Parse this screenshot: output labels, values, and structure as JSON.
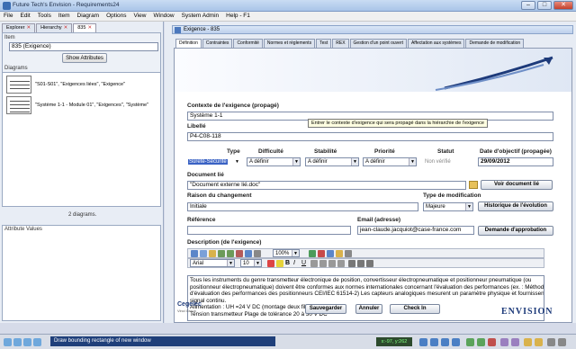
{
  "window": {
    "title": "Future Tech's Envision - Requirements24"
  },
  "menu": [
    "File",
    "Edit",
    "Tools",
    "Item",
    "Diagram",
    "Options",
    "View",
    "Window",
    "System Admin",
    "Help - F1"
  ],
  "left": {
    "tabs": [
      "Explorer",
      "Hierarchy",
      "835"
    ],
    "item_label": "Item",
    "item_value": "835 (Exigence)",
    "show_attributes": "Show Attributes",
    "diagrams_label": "Diagrams",
    "diagrams": [
      "\"S01-S01\", \"Exigences liées\", \"Exigence\"",
      "\"Système 1-1 - Module 01\", \"Exigences\", \"Système\""
    ],
    "diagrams_count": "2 diagrams.",
    "attribute_values_label": "Attribute Values"
  },
  "right": {
    "window_title": "Exigence - 835",
    "tabs": [
      "Définition",
      "Contraintes",
      "Conformité",
      "Normes et règlements",
      "Test",
      "REX",
      "Gestion d'un point ouvert",
      "Affectation aux systèmes",
      "Demande de modification"
    ],
    "form": {
      "contexte_label": "Contexte de l'exigence (propagé)",
      "contexte_value": "Système 1-1",
      "tooltip": "Entrer le contexte d'exigence qui sera propagé dans la hiérarchie de l'exigence",
      "libelle_label": "Libellé",
      "libelle_value": "P4-C08-118",
      "type_label": "Type",
      "type_value": "Sûreté-Sécurité",
      "difficulte_label": "Difficulté",
      "difficulte_value": "A définir",
      "stabilite_label": "Stabilité",
      "stabilite_value": "A définir",
      "priorite_label": "Priorité",
      "priorite_value": "A définir",
      "statut_label": "Statut",
      "statut_value": "Non vérifié",
      "date_label": "Date d'objectif (propagée)",
      "date_value": "29/09/2012",
      "doc_label": "Document lié",
      "doc_value": "\"Document externe lié.doc\"",
      "voir_doc": "Voir document lié",
      "raison_label": "Raison du changement",
      "raison_value": "Initiale",
      "typemod_label": "Type de modification",
      "typemod_value": "Majeure",
      "historique": "Historique de l'évolution",
      "reference_label": "Référence",
      "reference_value": "",
      "email_label": "Email (adresse)",
      "email_value": "jean-claude.jacquiot@case-france.com",
      "demande_approbation": "Demande d'approbation",
      "description_label": "Description (de l'exigence)",
      "font_name": "Arial",
      "font_size": "10",
      "zoom": "100%",
      "description_lines": [
        "Tous les instruments du genre transmetteur électronique de position, convertisseur électropneumatique et positionneur pneumatique (ou",
        "positionneur électropneumatique) doivent être conformes aux normes internationales concernant l'évaluation des performances (ex. :  Méthode",
        "d'évaluation des performances des positionneurs CEI/IEC 61514-2) Les capteurs analogiques mesurent un paramètre physique et fournissent un",
        "signal continu.",
        "Alimentation : UH =24 V DC (montage deux fils)",
        "Tension transmetteur Plage de tolérance 20 à 30 V DC"
      ],
      "sauvegarder": "Sauvegarder",
      "annuler": "Annuler",
      "checkin": "Check In",
      "logo_left": "Cegelec",
      "logo_left_sub": "Vinci Group",
      "logo_right": "ENVISION"
    }
  },
  "status": {
    "message": "Draw bounding rectangle of new window",
    "coords": "x:-97, y:262"
  },
  "colors": {
    "accent": "#1f3f7a",
    "title_bg": "#bdd0ec",
    "logo_blue": "#1d3a7a"
  }
}
